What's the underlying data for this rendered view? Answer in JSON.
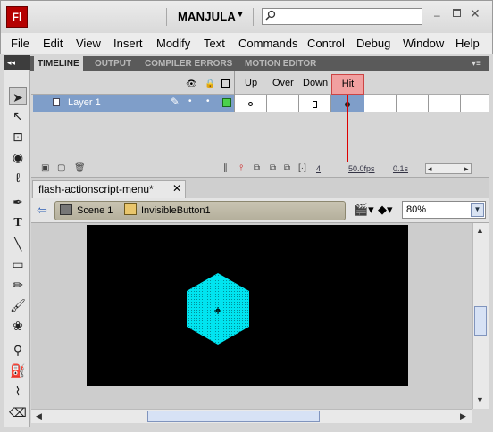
{
  "app": {
    "logo_text": "Fl",
    "workspace": "MANJULA",
    "search_placeholder": "",
    "window_controls": {
      "minimize": "–",
      "close": "✕"
    }
  },
  "menu": {
    "items": [
      "File",
      "Edit",
      "View",
      "Insert",
      "Modify",
      "Text",
      "Commands",
      "Control",
      "Debug",
      "Window",
      "Help"
    ]
  },
  "panel_tabs": {
    "items": [
      "TIMELINE",
      "OUTPUT",
      "COMPILER ERRORS",
      "MOTION EDITOR"
    ],
    "selected": "TIMELINE"
  },
  "timeline": {
    "frame_labels": [
      "Up",
      "Over",
      "Down",
      "Hit"
    ],
    "layer": {
      "name": "Layer 1",
      "color": "#4cd14c"
    },
    "current_frame": "4",
    "fps": "50.0fps",
    "elapsed": "0.1s"
  },
  "document": {
    "tab_title": "flash-actionscript-menu*",
    "close_glyph": "✕",
    "breadcrumb": [
      "Scene 1",
      "InvisibleButton1"
    ],
    "zoom": "80%"
  },
  "colors": {
    "stage_bg": "#000000",
    "hit_area_fill": "#00e4f0",
    "layer_selected": "#7f9ec9",
    "hit_header": "#f1a0a0"
  },
  "icons": {
    "tools": [
      "selection-tool-icon",
      "subselection-tool-icon",
      "free-transform-tool-icon",
      "3d-rotation-tool-icon",
      "lasso-tool-icon",
      "pen-tool-icon",
      "text-tool-icon",
      "line-tool-icon",
      "rectangle-tool-icon",
      "pencil-tool-icon",
      "brush-tool-icon",
      "deco-tool-icon",
      "bone-tool-icon",
      "paint-bucket-tool-icon",
      "eyedropper-tool-icon",
      "eraser-tool-icon"
    ]
  }
}
